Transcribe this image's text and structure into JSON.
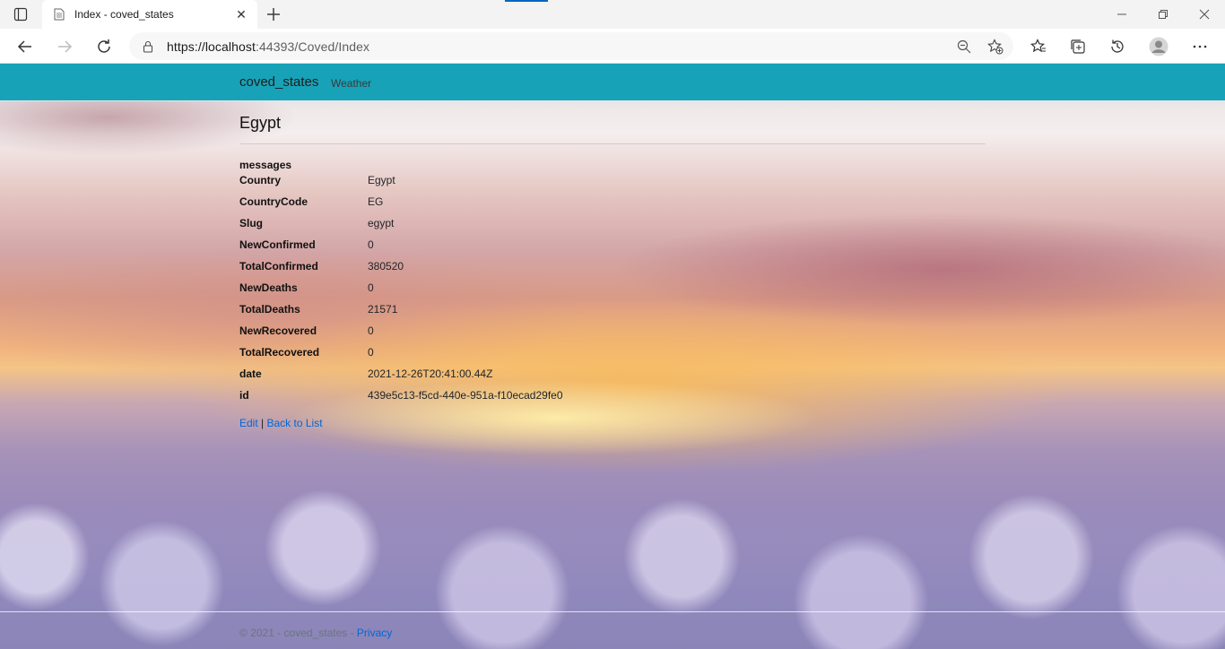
{
  "browser": {
    "tab_title": "Index - coved_states",
    "url_host": "https://localhost",
    "url_rest": ":44393/Coved/Index"
  },
  "navbar": {
    "brand": "coved_states",
    "links": [
      "Weather"
    ]
  },
  "details": {
    "title": "Egypt",
    "heading": "messages",
    "fields": [
      {
        "key": "Country",
        "value": "Egypt"
      },
      {
        "key": "CountryCode",
        "value": "EG"
      },
      {
        "key": "Slug",
        "value": "egypt"
      },
      {
        "key": "NewConfirmed",
        "value": "0"
      },
      {
        "key": "TotalConfirmed",
        "value": "380520"
      },
      {
        "key": "NewDeaths",
        "value": "0"
      },
      {
        "key": "TotalDeaths",
        "value": "21571"
      },
      {
        "key": "NewRecovered",
        "value": "0"
      },
      {
        "key": "TotalRecovered",
        "value": "0"
      },
      {
        "key": "date",
        "value": "2021-12-26T20:41:00.44Z"
      },
      {
        "key": "id",
        "value": "439e5c13-f5cd-440e-951a-f10ecad29fe0"
      }
    ],
    "edit_label": "Edit",
    "separator": "|",
    "back_label": "Back to List"
  },
  "footer": {
    "text": "© 2021 - coved_states - ",
    "privacy_label": "Privacy"
  },
  "colors": {
    "navbar": "#17a2b8",
    "link": "#0366d6"
  }
}
